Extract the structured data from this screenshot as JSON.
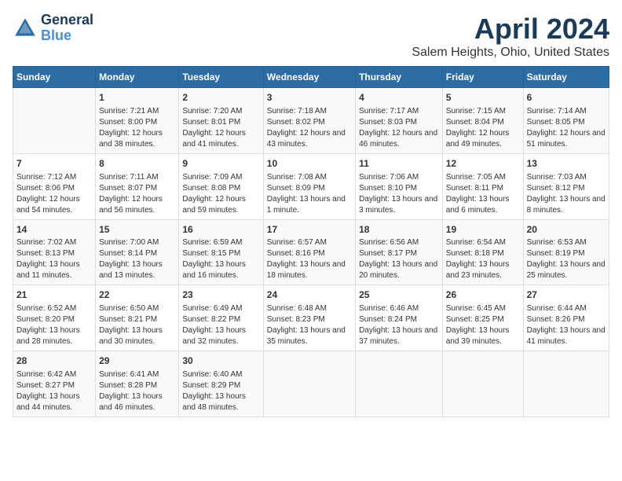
{
  "logo": {
    "line1": "General",
    "line2": "Blue"
  },
  "title": "April 2024",
  "subtitle": "Salem Heights, Ohio, United States",
  "days_of_week": [
    "Sunday",
    "Monday",
    "Tuesday",
    "Wednesday",
    "Thursday",
    "Friday",
    "Saturday"
  ],
  "weeks": [
    [
      {
        "num": "",
        "sunrise": "",
        "sunset": "",
        "daylight": ""
      },
      {
        "num": "1",
        "sunrise": "Sunrise: 7:21 AM",
        "sunset": "Sunset: 8:00 PM",
        "daylight": "Daylight: 12 hours and 38 minutes."
      },
      {
        "num": "2",
        "sunrise": "Sunrise: 7:20 AM",
        "sunset": "Sunset: 8:01 PM",
        "daylight": "Daylight: 12 hours and 41 minutes."
      },
      {
        "num": "3",
        "sunrise": "Sunrise: 7:18 AM",
        "sunset": "Sunset: 8:02 PM",
        "daylight": "Daylight: 12 hours and 43 minutes."
      },
      {
        "num": "4",
        "sunrise": "Sunrise: 7:17 AM",
        "sunset": "Sunset: 8:03 PM",
        "daylight": "Daylight: 12 hours and 46 minutes."
      },
      {
        "num": "5",
        "sunrise": "Sunrise: 7:15 AM",
        "sunset": "Sunset: 8:04 PM",
        "daylight": "Daylight: 12 hours and 49 minutes."
      },
      {
        "num": "6",
        "sunrise": "Sunrise: 7:14 AM",
        "sunset": "Sunset: 8:05 PM",
        "daylight": "Daylight: 12 hours and 51 minutes."
      }
    ],
    [
      {
        "num": "7",
        "sunrise": "Sunrise: 7:12 AM",
        "sunset": "Sunset: 8:06 PM",
        "daylight": "Daylight: 12 hours and 54 minutes."
      },
      {
        "num": "8",
        "sunrise": "Sunrise: 7:11 AM",
        "sunset": "Sunset: 8:07 PM",
        "daylight": "Daylight: 12 hours and 56 minutes."
      },
      {
        "num": "9",
        "sunrise": "Sunrise: 7:09 AM",
        "sunset": "Sunset: 8:08 PM",
        "daylight": "Daylight: 12 hours and 59 minutes."
      },
      {
        "num": "10",
        "sunrise": "Sunrise: 7:08 AM",
        "sunset": "Sunset: 8:09 PM",
        "daylight": "Daylight: 13 hours and 1 minute."
      },
      {
        "num": "11",
        "sunrise": "Sunrise: 7:06 AM",
        "sunset": "Sunset: 8:10 PM",
        "daylight": "Daylight: 13 hours and 3 minutes."
      },
      {
        "num": "12",
        "sunrise": "Sunrise: 7:05 AM",
        "sunset": "Sunset: 8:11 PM",
        "daylight": "Daylight: 13 hours and 6 minutes."
      },
      {
        "num": "13",
        "sunrise": "Sunrise: 7:03 AM",
        "sunset": "Sunset: 8:12 PM",
        "daylight": "Daylight: 13 hours and 8 minutes."
      }
    ],
    [
      {
        "num": "14",
        "sunrise": "Sunrise: 7:02 AM",
        "sunset": "Sunset: 8:13 PM",
        "daylight": "Daylight: 13 hours and 11 minutes."
      },
      {
        "num": "15",
        "sunrise": "Sunrise: 7:00 AM",
        "sunset": "Sunset: 8:14 PM",
        "daylight": "Daylight: 13 hours and 13 minutes."
      },
      {
        "num": "16",
        "sunrise": "Sunrise: 6:59 AM",
        "sunset": "Sunset: 8:15 PM",
        "daylight": "Daylight: 13 hours and 16 minutes."
      },
      {
        "num": "17",
        "sunrise": "Sunrise: 6:57 AM",
        "sunset": "Sunset: 8:16 PM",
        "daylight": "Daylight: 13 hours and 18 minutes."
      },
      {
        "num": "18",
        "sunrise": "Sunrise: 6:56 AM",
        "sunset": "Sunset: 8:17 PM",
        "daylight": "Daylight: 13 hours and 20 minutes."
      },
      {
        "num": "19",
        "sunrise": "Sunrise: 6:54 AM",
        "sunset": "Sunset: 8:18 PM",
        "daylight": "Daylight: 13 hours and 23 minutes."
      },
      {
        "num": "20",
        "sunrise": "Sunrise: 6:53 AM",
        "sunset": "Sunset: 8:19 PM",
        "daylight": "Daylight: 13 hours and 25 minutes."
      }
    ],
    [
      {
        "num": "21",
        "sunrise": "Sunrise: 6:52 AM",
        "sunset": "Sunset: 8:20 PM",
        "daylight": "Daylight: 13 hours and 28 minutes."
      },
      {
        "num": "22",
        "sunrise": "Sunrise: 6:50 AM",
        "sunset": "Sunset: 8:21 PM",
        "daylight": "Daylight: 13 hours and 30 minutes."
      },
      {
        "num": "23",
        "sunrise": "Sunrise: 6:49 AM",
        "sunset": "Sunset: 8:22 PM",
        "daylight": "Daylight: 13 hours and 32 minutes."
      },
      {
        "num": "24",
        "sunrise": "Sunrise: 6:48 AM",
        "sunset": "Sunset: 8:23 PM",
        "daylight": "Daylight: 13 hours and 35 minutes."
      },
      {
        "num": "25",
        "sunrise": "Sunrise: 6:46 AM",
        "sunset": "Sunset: 8:24 PM",
        "daylight": "Daylight: 13 hours and 37 minutes."
      },
      {
        "num": "26",
        "sunrise": "Sunrise: 6:45 AM",
        "sunset": "Sunset: 8:25 PM",
        "daylight": "Daylight: 13 hours and 39 minutes."
      },
      {
        "num": "27",
        "sunrise": "Sunrise: 6:44 AM",
        "sunset": "Sunset: 8:26 PM",
        "daylight": "Daylight: 13 hours and 41 minutes."
      }
    ],
    [
      {
        "num": "28",
        "sunrise": "Sunrise: 6:42 AM",
        "sunset": "Sunset: 8:27 PM",
        "daylight": "Daylight: 13 hours and 44 minutes."
      },
      {
        "num": "29",
        "sunrise": "Sunrise: 6:41 AM",
        "sunset": "Sunset: 8:28 PM",
        "daylight": "Daylight: 13 hours and 46 minutes."
      },
      {
        "num": "30",
        "sunrise": "Sunrise: 6:40 AM",
        "sunset": "Sunset: 8:29 PM",
        "daylight": "Daylight: 13 hours and 48 minutes."
      },
      {
        "num": "",
        "sunrise": "",
        "sunset": "",
        "daylight": ""
      },
      {
        "num": "",
        "sunrise": "",
        "sunset": "",
        "daylight": ""
      },
      {
        "num": "",
        "sunrise": "",
        "sunset": "",
        "daylight": ""
      },
      {
        "num": "",
        "sunrise": "",
        "sunset": "",
        "daylight": ""
      }
    ]
  ]
}
